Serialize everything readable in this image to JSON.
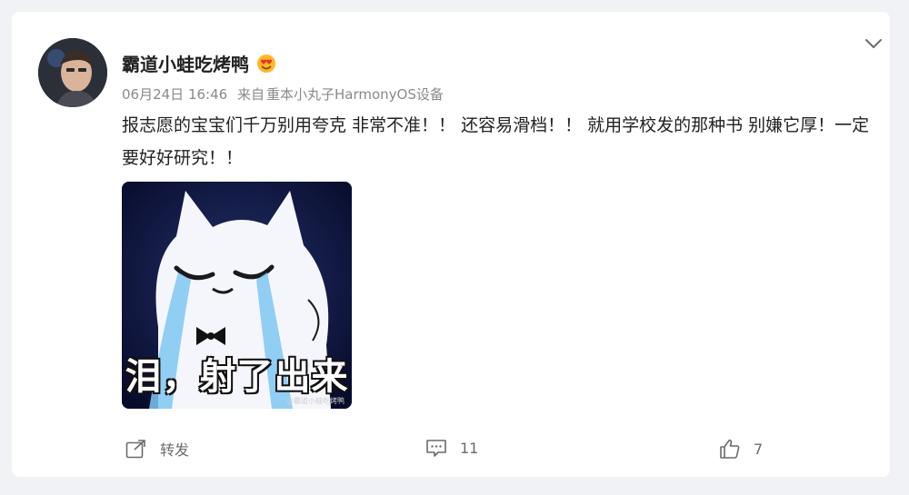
{
  "post": {
    "user_name": "霸道小蛙吃烤鸭",
    "date": "06月24日 16:46",
    "source_prefix": "来自",
    "source_device": "重本小丸子HarmonyOS设备",
    "text": "报志愿的宝宝们千万别用夸克 非常不准！！ 还容易滑档！！ 就用学校发的那种书 别嫌它厚！一定要好好研究！！",
    "image_caption": "泪，射了出来",
    "image_watermark": "@霸道小蛙吃烤鸭"
  },
  "icons": {
    "more": "chevron-down-icon",
    "badge": "heart-eyes-emoji-icon",
    "repost": "share-icon",
    "comment": "comment-icon",
    "like": "thumbs-up-icon"
  },
  "actions": {
    "repost_label": "转发",
    "comment_count": "11",
    "like_count": "7"
  },
  "colors": {
    "background": "#f1f2f5",
    "card": "#ffffff",
    "meta_text": "#8a8a8a",
    "badge": "#ff8200"
  }
}
